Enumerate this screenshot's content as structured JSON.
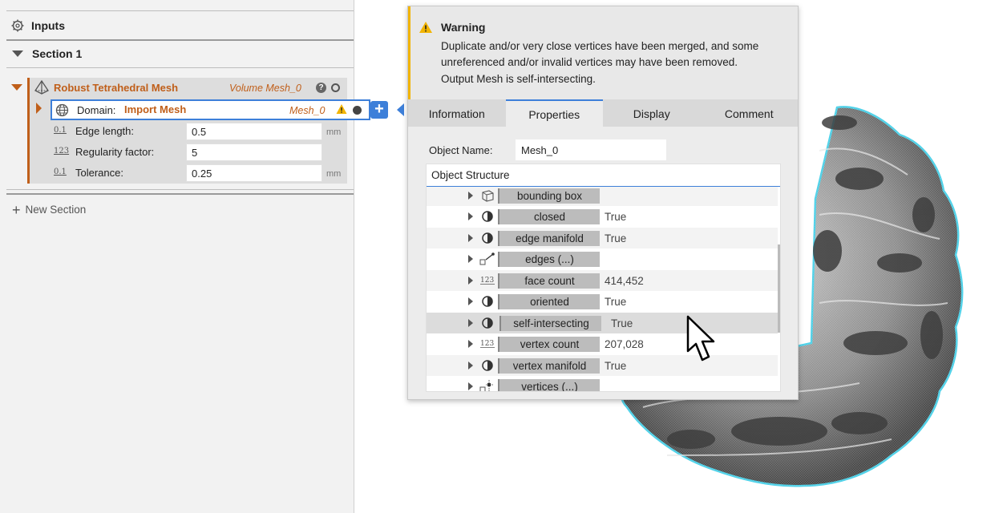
{
  "left_panel": {
    "inputs_label": "Inputs",
    "section_label": "Section 1",
    "block": {
      "title": "Robust Tetrahedral Mesh",
      "output": "Volume Mesh_0",
      "domain": {
        "key": "Domain:",
        "value": "Import Mesh",
        "output": "Mesh_0"
      },
      "params": [
        {
          "label": "Edge length:",
          "value": "0.5",
          "unit": "mm",
          "icon": "0.1"
        },
        {
          "label": "Regularity factor:",
          "value": "5",
          "unit": "",
          "icon": "123"
        },
        {
          "label": "Tolerance:",
          "value": "0.25",
          "unit": "mm",
          "icon": "0.1"
        }
      ]
    },
    "new_section_label": "New Section"
  },
  "popup": {
    "warning_title": "Warning",
    "warning_lines": [
      "Duplicate and/or very close vertices have been merged, and some",
      "unreferenced and/or invalid vertices may have been removed.",
      "Output Mesh is self-intersecting."
    ],
    "tabs": [
      "Information",
      "Properties",
      "Display",
      "Comment"
    ],
    "active_tab": "Properties",
    "object_name_label": "Object Name:",
    "object_name_value": "Mesh_0",
    "structure_label": "Object Structure",
    "rows": [
      {
        "name": "bounding box",
        "value": "",
        "icon": "box-icon"
      },
      {
        "name": "closed",
        "value": "True",
        "icon": "half-circle-icon"
      },
      {
        "name": "edge manifold",
        "value": "True",
        "icon": "half-circle-icon"
      },
      {
        "name": "edges (...)",
        "value": "",
        "icon": "edges-icon"
      },
      {
        "name": "face count",
        "value": "414,452",
        "icon": "number-icon"
      },
      {
        "name": "oriented",
        "value": "True",
        "icon": "half-circle-icon"
      },
      {
        "name": "self-intersecting",
        "value": "True",
        "icon": "half-circle-icon"
      },
      {
        "name": "vertex count",
        "value": "207,028",
        "icon": "number-icon"
      },
      {
        "name": "vertex manifold",
        "value": "True",
        "icon": "half-circle-icon"
      },
      {
        "name": "vertices (...)",
        "value": "",
        "icon": "vertices-icon"
      }
    ]
  },
  "colors": {
    "accent": "#3d7fd9",
    "brand_orange": "#c05f1a",
    "warning": "#f2b400",
    "object_glow": "#4fd1e8"
  }
}
